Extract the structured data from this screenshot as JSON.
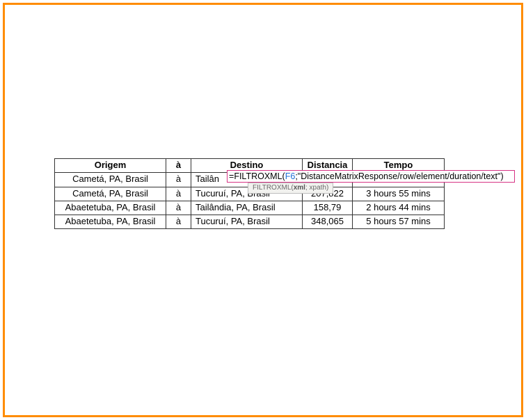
{
  "table": {
    "headers": {
      "origem": "Origem",
      "a": "à",
      "destino": "Destino",
      "dist": "Distancia",
      "tempo": "Tempo"
    },
    "rows": [
      {
        "origem": "Cametá, PA, Brasil",
        "a": "à",
        "destino": "Tailândia, PA, Brasil",
        "dist": "",
        "tempo": ""
      },
      {
        "origem": "Cametá, PA, Brasil",
        "a": "à",
        "destino": "Tucuruí, PA, Brasil",
        "dist": "207,822",
        "tempo": "3 hours 55 mins"
      },
      {
        "origem": "Abaetetuba, PA, Brasil",
        "a": "à",
        "destino": "Tailândia, PA, Brasil",
        "dist": "158,79",
        "tempo": "2 hours 44 mins"
      },
      {
        "origem": "Abaetetuba, PA, Brasil",
        "a": "à",
        "destino": "Tucuruí, PA, Brasil",
        "dist": "348,065",
        "tempo": "5 hours 57 mins"
      }
    ],
    "row0_destino_visible": "Tailân"
  },
  "formula": {
    "eq": "=",
    "func": "FILTROXML",
    "open": "(",
    "ref": "F6",
    "sep": ";",
    "arg2": "\"DistanceMatrixResponse/row/element/duration/text\"",
    "close": ")"
  },
  "hint": {
    "text_prefix": "FILTROXML(",
    "text_bold": "xml",
    "text_suffix": "; xpath)"
  }
}
